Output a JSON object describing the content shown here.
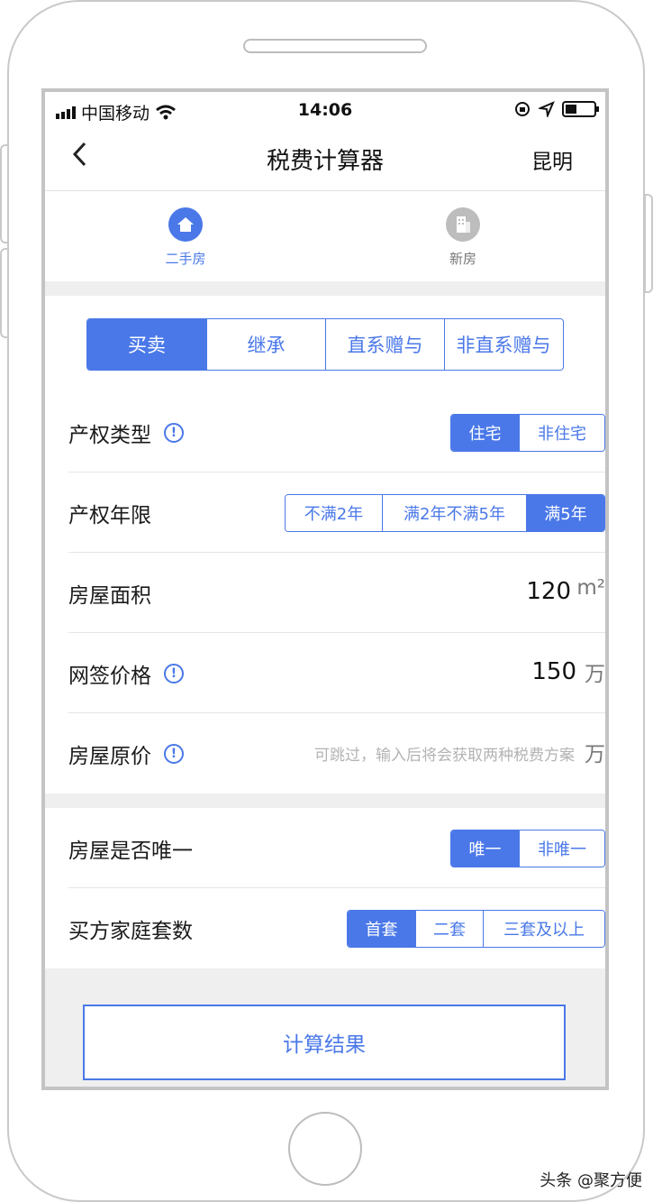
{
  "status": {
    "carrier": "中国移动",
    "time": "14:06"
  },
  "nav": {
    "title": "税费计算器",
    "city": "昆明"
  },
  "house_tabs": [
    {
      "label": "二手房",
      "active": true
    },
    {
      "label": "新房",
      "active": false
    }
  ],
  "trade_tabs": [
    {
      "label": "买卖",
      "active": true
    },
    {
      "label": "继承",
      "active": false
    },
    {
      "label": "直系赠与",
      "active": false
    },
    {
      "label": "非直系赠与",
      "active": false
    }
  ],
  "property_type": {
    "label": "产权类型",
    "options": [
      {
        "label": "住宅",
        "active": true
      },
      {
        "label": "非住宅",
        "active": false
      }
    ]
  },
  "property_years": {
    "label": "产权年限",
    "options": [
      {
        "label": "不满2年",
        "active": false
      },
      {
        "label": "满2年不满5年",
        "active": false
      },
      {
        "label": "满5年",
        "active": true
      }
    ]
  },
  "area": {
    "label": "房屋面积",
    "value": "120",
    "unit": "m²"
  },
  "price": {
    "label": "网签价格",
    "value": "150",
    "unit": "万"
  },
  "original_price": {
    "label": "房屋原价",
    "placeholder": "可跳过，输入后将会获取两种税费方案",
    "unit": "万"
  },
  "unique": {
    "label": "房屋是否唯一",
    "options": [
      {
        "label": "唯一",
        "active": true
      },
      {
        "label": "非唯一",
        "active": false
      }
    ]
  },
  "family_count": {
    "label": "买方家庭套数",
    "options": [
      {
        "label": "首套",
        "active": true
      },
      {
        "label": "二套",
        "active": false
      },
      {
        "label": "三套及以上",
        "active": false
      }
    ]
  },
  "calc_button": "计算结果",
  "watermark": "头条 @聚方便",
  "colors": {
    "accent": "#4a78e8",
    "gray_icon": "#bdbdbd"
  }
}
